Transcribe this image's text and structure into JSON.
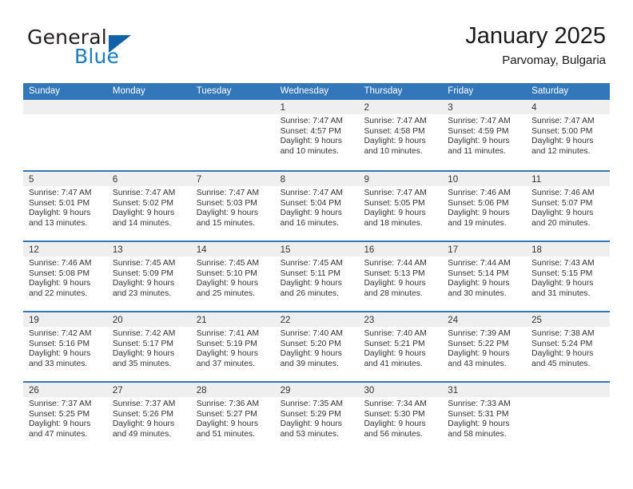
{
  "logo": {
    "word_one": "General",
    "word_two": "Blue",
    "triangle_color": "#1061a8",
    "blue_color": "#1c7cc0"
  },
  "header": {
    "title": "January 2025",
    "subtitle": "Parvomay, Bulgaria"
  },
  "theme": {
    "header_blue": "#3377bb",
    "day_head_gray": "#efefef",
    "text": "#333333"
  },
  "weekdays": [
    "Sunday",
    "Monday",
    "Tuesday",
    "Wednesday",
    "Thursday",
    "Friday",
    "Saturday"
  ],
  "weeks": [
    [
      {
        "day": "",
        "lines": []
      },
      {
        "day": "",
        "lines": []
      },
      {
        "day": "",
        "lines": []
      },
      {
        "day": "1",
        "lines": [
          "Sunrise: 7:47 AM",
          "Sunset: 4:57 PM",
          "Daylight: 9 hours",
          "and 10 minutes."
        ]
      },
      {
        "day": "2",
        "lines": [
          "Sunrise: 7:47 AM",
          "Sunset: 4:58 PM",
          "Daylight: 9 hours",
          "and 10 minutes."
        ]
      },
      {
        "day": "3",
        "lines": [
          "Sunrise: 7:47 AM",
          "Sunset: 4:59 PM",
          "Daylight: 9 hours",
          "and 11 minutes."
        ]
      },
      {
        "day": "4",
        "lines": [
          "Sunrise: 7:47 AM",
          "Sunset: 5:00 PM",
          "Daylight: 9 hours",
          "and 12 minutes."
        ]
      }
    ],
    [
      {
        "day": "5",
        "lines": [
          "Sunrise: 7:47 AM",
          "Sunset: 5:01 PM",
          "Daylight: 9 hours",
          "and 13 minutes."
        ]
      },
      {
        "day": "6",
        "lines": [
          "Sunrise: 7:47 AM",
          "Sunset: 5:02 PM",
          "Daylight: 9 hours",
          "and 14 minutes."
        ]
      },
      {
        "day": "7",
        "lines": [
          "Sunrise: 7:47 AM",
          "Sunset: 5:03 PM",
          "Daylight: 9 hours",
          "and 15 minutes."
        ]
      },
      {
        "day": "8",
        "lines": [
          "Sunrise: 7:47 AM",
          "Sunset: 5:04 PM",
          "Daylight: 9 hours",
          "and 16 minutes."
        ]
      },
      {
        "day": "9",
        "lines": [
          "Sunrise: 7:47 AM",
          "Sunset: 5:05 PM",
          "Daylight: 9 hours",
          "and 18 minutes."
        ]
      },
      {
        "day": "10",
        "lines": [
          "Sunrise: 7:46 AM",
          "Sunset: 5:06 PM",
          "Daylight: 9 hours",
          "and 19 minutes."
        ]
      },
      {
        "day": "11",
        "lines": [
          "Sunrise: 7:46 AM",
          "Sunset: 5:07 PM",
          "Daylight: 9 hours",
          "and 20 minutes."
        ]
      }
    ],
    [
      {
        "day": "12",
        "lines": [
          "Sunrise: 7:46 AM",
          "Sunset: 5:08 PM",
          "Daylight: 9 hours",
          "and 22 minutes."
        ]
      },
      {
        "day": "13",
        "lines": [
          "Sunrise: 7:45 AM",
          "Sunset: 5:09 PM",
          "Daylight: 9 hours",
          "and 23 minutes."
        ]
      },
      {
        "day": "14",
        "lines": [
          "Sunrise: 7:45 AM",
          "Sunset: 5:10 PM",
          "Daylight: 9 hours",
          "and 25 minutes."
        ]
      },
      {
        "day": "15",
        "lines": [
          "Sunrise: 7:45 AM",
          "Sunset: 5:11 PM",
          "Daylight: 9 hours",
          "and 26 minutes."
        ]
      },
      {
        "day": "16",
        "lines": [
          "Sunrise: 7:44 AM",
          "Sunset: 5:13 PM",
          "Daylight: 9 hours",
          "and 28 minutes."
        ]
      },
      {
        "day": "17",
        "lines": [
          "Sunrise: 7:44 AM",
          "Sunset: 5:14 PM",
          "Daylight: 9 hours",
          "and 30 minutes."
        ]
      },
      {
        "day": "18",
        "lines": [
          "Sunrise: 7:43 AM",
          "Sunset: 5:15 PM",
          "Daylight: 9 hours",
          "and 31 minutes."
        ]
      }
    ],
    [
      {
        "day": "19",
        "lines": [
          "Sunrise: 7:42 AM",
          "Sunset: 5:16 PM",
          "Daylight: 9 hours",
          "and 33 minutes."
        ]
      },
      {
        "day": "20",
        "lines": [
          "Sunrise: 7:42 AM",
          "Sunset: 5:17 PM",
          "Daylight: 9 hours",
          "and 35 minutes."
        ]
      },
      {
        "day": "21",
        "lines": [
          "Sunrise: 7:41 AM",
          "Sunset: 5:19 PM",
          "Daylight: 9 hours",
          "and 37 minutes."
        ]
      },
      {
        "day": "22",
        "lines": [
          "Sunrise: 7:40 AM",
          "Sunset: 5:20 PM",
          "Daylight: 9 hours",
          "and 39 minutes."
        ]
      },
      {
        "day": "23",
        "lines": [
          "Sunrise: 7:40 AM",
          "Sunset: 5:21 PM",
          "Daylight: 9 hours",
          "and 41 minutes."
        ]
      },
      {
        "day": "24",
        "lines": [
          "Sunrise: 7:39 AM",
          "Sunset: 5:22 PM",
          "Daylight: 9 hours",
          "and 43 minutes."
        ]
      },
      {
        "day": "25",
        "lines": [
          "Sunrise: 7:38 AM",
          "Sunset: 5:24 PM",
          "Daylight: 9 hours",
          "and 45 minutes."
        ]
      }
    ],
    [
      {
        "day": "26",
        "lines": [
          "Sunrise: 7:37 AM",
          "Sunset: 5:25 PM",
          "Daylight: 9 hours",
          "and 47 minutes."
        ]
      },
      {
        "day": "27",
        "lines": [
          "Sunrise: 7:37 AM",
          "Sunset: 5:26 PM",
          "Daylight: 9 hours",
          "and 49 minutes."
        ]
      },
      {
        "day": "28",
        "lines": [
          "Sunrise: 7:36 AM",
          "Sunset: 5:27 PM",
          "Daylight: 9 hours",
          "and 51 minutes."
        ]
      },
      {
        "day": "29",
        "lines": [
          "Sunrise: 7:35 AM",
          "Sunset: 5:29 PM",
          "Daylight: 9 hours",
          "and 53 minutes."
        ]
      },
      {
        "day": "30",
        "lines": [
          "Sunrise: 7:34 AM",
          "Sunset: 5:30 PM",
          "Daylight: 9 hours",
          "and 56 minutes."
        ]
      },
      {
        "day": "31",
        "lines": [
          "Sunrise: 7:33 AM",
          "Sunset: 5:31 PM",
          "Daylight: 9 hours",
          "and 58 minutes."
        ]
      },
      {
        "day": "",
        "lines": []
      }
    ]
  ]
}
